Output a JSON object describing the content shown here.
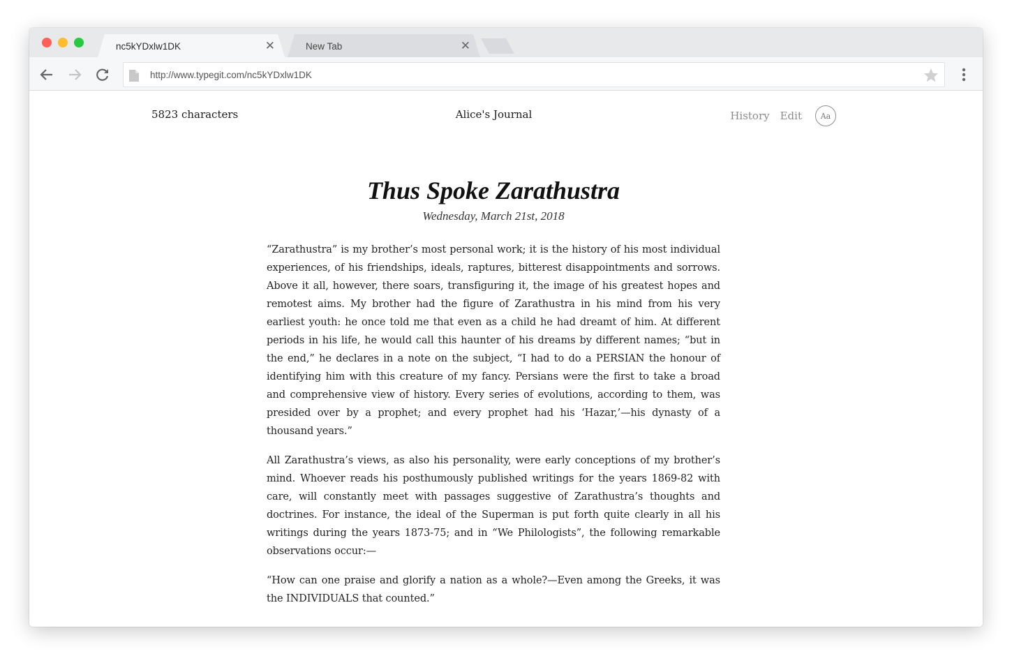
{
  "browser": {
    "tabs": [
      {
        "title": "nc5kYDxlw1DK",
        "close": "✕",
        "active": true
      },
      {
        "title": "New Tab",
        "close": "✕",
        "active": false
      }
    ],
    "url": "http://www.typegit.com/nc5kYDxlw1DK",
    "traffic_colors": {
      "close": "#fe5f57",
      "minimize": "#febc2e",
      "zoom": "#28c840"
    }
  },
  "header": {
    "char_count": "5823 characters",
    "journal_name": "Alice's Journal",
    "history_label": "History",
    "edit_label": "Edit",
    "font_toggle_label": "Aa"
  },
  "article": {
    "title": "Thus Spoke Zarathustra",
    "date": "Wednesday, March 21st, 2018",
    "paragraphs": [
      "“Zarathustra” is my brother’s most personal work; it is the history of his most individual experiences, of his friendships, ideals, raptures, bitterest disappointments and sorrows. Above it all, however, there soars, transfiguring it, the image of his greatest hopes and remotest aims. My brother had the figure of Zarathustra in his mind from his very earliest youth: he once told me that even as a child he had dreamt of him. At different periods in his life, he would call this haunter of his dreams by different names; “but in the end,” he declares in a note on the subject, “I had to do a PERSIAN the honour of identifying him with this creature of my fancy. Persians were the first to take a broad and comprehensive view of history. Every series of evolutions, according to them, was presided over by a prophet; and every prophet had his ‘Hazar,’—his dynasty of a thousand years.”",
      "All Zarathustra’s views, as also his personality, were early conceptions of my brother’s mind. Whoever reads his posthumously published writings for the years 1869-82 with care, will constantly meet with passages suggestive of Zarathustra’s thoughts and doctrines. For instance, the ideal of the Superman is put forth quite clearly in all his writings during the years 1873-75; and in “We Philologists”, the following remarkable observations occur:—",
      "“How can one praise and glorify a nation as a whole?—Even among the Greeks, it was the INDIVIDUALS that counted.”"
    ]
  }
}
